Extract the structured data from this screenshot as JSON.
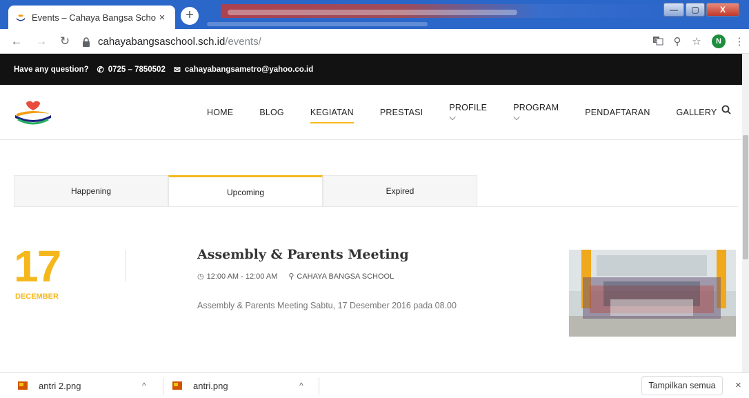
{
  "browser": {
    "tab_title": "Events – Cahaya Bangsa School",
    "tab_close": "×",
    "new_tab": "+",
    "url_host": "cahayabangsaschool.sch.id",
    "url_path": "/events/",
    "profile_initial": "N",
    "window_controls": {
      "minimize": "—",
      "maximize": "▢",
      "close": "X"
    }
  },
  "topbar": {
    "question": "Have any question?",
    "phone": "0725 – 7850502",
    "email": "cahayabangsametro@yahoo.co.id"
  },
  "nav": {
    "items": [
      "HOME",
      "BLOG",
      "KEGIATAN",
      "PRESTASI",
      "PROFILE ⌵",
      "PROGRAM ⌵",
      "PENDAFTARAN",
      "GALLERY"
    ],
    "active": "KEGIATAN"
  },
  "tabs": [
    "Happening",
    "Upcoming",
    "Expired"
  ],
  "selected_tab": "Upcoming",
  "event": {
    "day": "17",
    "month": "DECEMBER",
    "title": "Assembly & Parents Meeting",
    "time": "12:00 AM - 12:00 AM",
    "location": "CAHAYA BANGSA SCHOOL",
    "description": "Assembly & Parents Meeting Sabtu, 17 Desember 2016 pada 08.00"
  },
  "downloads": [
    {
      "name": "antri 2.png"
    },
    {
      "name": "antri.png"
    }
  ],
  "download_bar": {
    "show_all": "Tampilkan semua",
    "close": "×"
  },
  "colors": {
    "accent": "#f5b81c",
    "topbar": "#121212",
    "chrome": "#2b66c9"
  }
}
